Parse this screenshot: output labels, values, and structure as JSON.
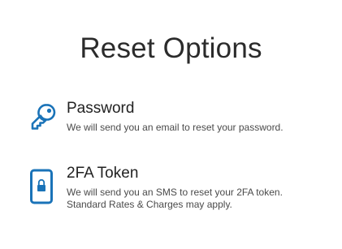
{
  "page": {
    "title": "Reset Options"
  },
  "options": [
    {
      "icon": "key-icon",
      "title": "Password",
      "description": "We will send you an email to reset your password."
    },
    {
      "icon": "phone-lock-icon",
      "title": "2FA Token",
      "description": "We will send you an SMS to reset your 2FA token.\nStandard Rates & Charges may apply."
    }
  ],
  "colors": {
    "icon_accent": "#1a73b8",
    "title_text": "#2b2b2b",
    "body_text": "#4a4a4a"
  }
}
